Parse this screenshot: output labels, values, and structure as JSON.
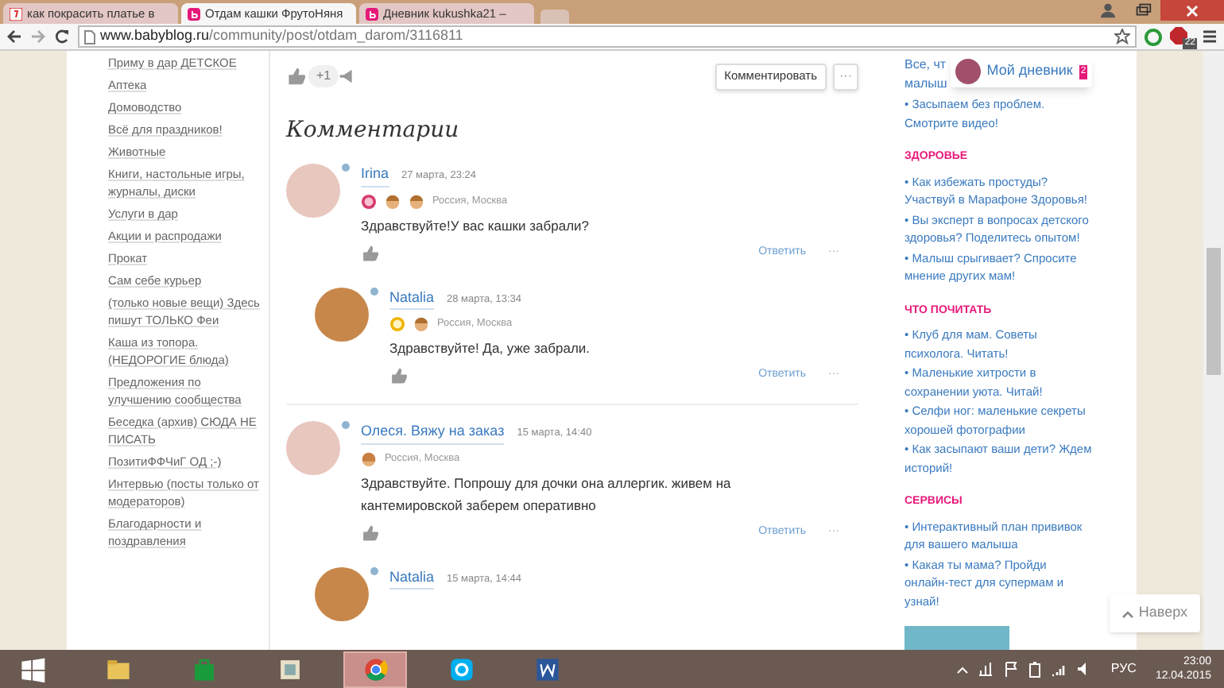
{
  "browser": {
    "tabs": [
      {
        "title": "как покрасить платье в",
        "selected": false
      },
      {
        "title": "Отдам кашки ФрутоНяня",
        "selected": true
      },
      {
        "title": "Дневник kukushka21 –",
        "selected": false
      }
    ],
    "url": {
      "domain": "www.babyblog.ru",
      "path": "/community/post/otdam_darom/3116811"
    },
    "extension_badge": "22"
  },
  "sidebar": {
    "items": [
      "Приму в дар ДЕТСКОЕ",
      "Аптека",
      "Домоводство",
      "Всё для праздников!",
      "Животные",
      "Книги, настольные игры, журналы, диски",
      "Услуги в дар",
      "Акции и распродажи",
      "Прокат",
      "Сам себе курьер",
      "(только новые вещи) Здесь пишут ТОЛЬКО Феи",
      "Каша из топора. (НЕДОРОГИЕ блюда)",
      "Предложения по улучшению сообщества",
      "Беседка (архив) СЮДА НЕ ПИСАТЬ",
      "ПозитиФФЧиГ ОД ;-)",
      "Интервью (посты только от модераторов)",
      "Благодарности и поздравления"
    ]
  },
  "post_actions": {
    "likes": "+1",
    "comment_button": "Комментировать",
    "more": "···"
  },
  "comments_title": "Комментарии",
  "comments": [
    {
      "author": "Irina",
      "date": "27 марта, 23:24",
      "location": "Россия, Москва",
      "text": "Здравствуйте!У вас кашки забрали?",
      "reply": "Ответить",
      "more": "···",
      "children": [
        {
          "author": "Natalia",
          "date": "28 марта, 13:34",
          "location": "Россия, Москва",
          "text": "Здравствуйте! Да, уже забрали.",
          "reply": "Ответить",
          "more": "···"
        }
      ]
    },
    {
      "author": "Олеся. Вяжу на заказ",
      "date": "15 марта, 14:40",
      "location": "Россия, Москва",
      "text": "Здравствуйте. Попрошу для дочки она аллергик. живем на кантемировской заберем оперативно",
      "reply": "Ответить",
      "more": "···",
      "children": [
        {
          "author": "Natalia",
          "date": "15 марта, 14:44"
        }
      ]
    }
  ],
  "right_column": {
    "partial_lines": [
      "Все, чт",
      "малыш"
    ],
    "sections": [
      {
        "links": [
          "• Засыпаем без проблем. Смотрите видео!"
        ]
      },
      {
        "heading": "ЗДОРОВЬЕ",
        "links": [
          "• Как избежать простуды? Участвуй в Марафоне Здоровья!",
          "• Вы эксперт в вопросах детского здоровья? Поделитесь опытом!",
          "• Малыш срыгивает? Спросите мнение других мам!"
        ]
      },
      {
        "heading": "ЧТО ПОЧИТАТЬ",
        "links": [
          "• Клуб для мам. Советы психолога. Читать!",
          "• Маленькие хитрости в сохранении уюта. Читай!",
          "• Селфи ног: маленькие секреты хорошей фотографии",
          "• Как засыпают ваши дети? Ждем историй!"
        ]
      },
      {
        "heading": "СЕРВИСЫ",
        "links": [
          "• Интерактивный план прививок для вашего малыша",
          "• Какая ты мама? Пройди онлайн-тест для супермам и узнай!"
        ]
      }
    ]
  },
  "diary_popup": {
    "label": "Мой дневник",
    "count": "2"
  },
  "to_top": "Наверх",
  "taskbar": {
    "apps": [
      {
        "kind": "start",
        "selected": false
      },
      {
        "kind": "explorer",
        "selected": false
      },
      {
        "kind": "store",
        "selected": false
      },
      {
        "kind": "notes",
        "selected": false
      },
      {
        "kind": "chrome",
        "selected": true
      },
      {
        "kind": "skype",
        "selected": false
      },
      {
        "kind": "word",
        "selected": false
      }
    ],
    "language": "РУС",
    "time": "23:00",
    "date": "12.04.2015"
  }
}
